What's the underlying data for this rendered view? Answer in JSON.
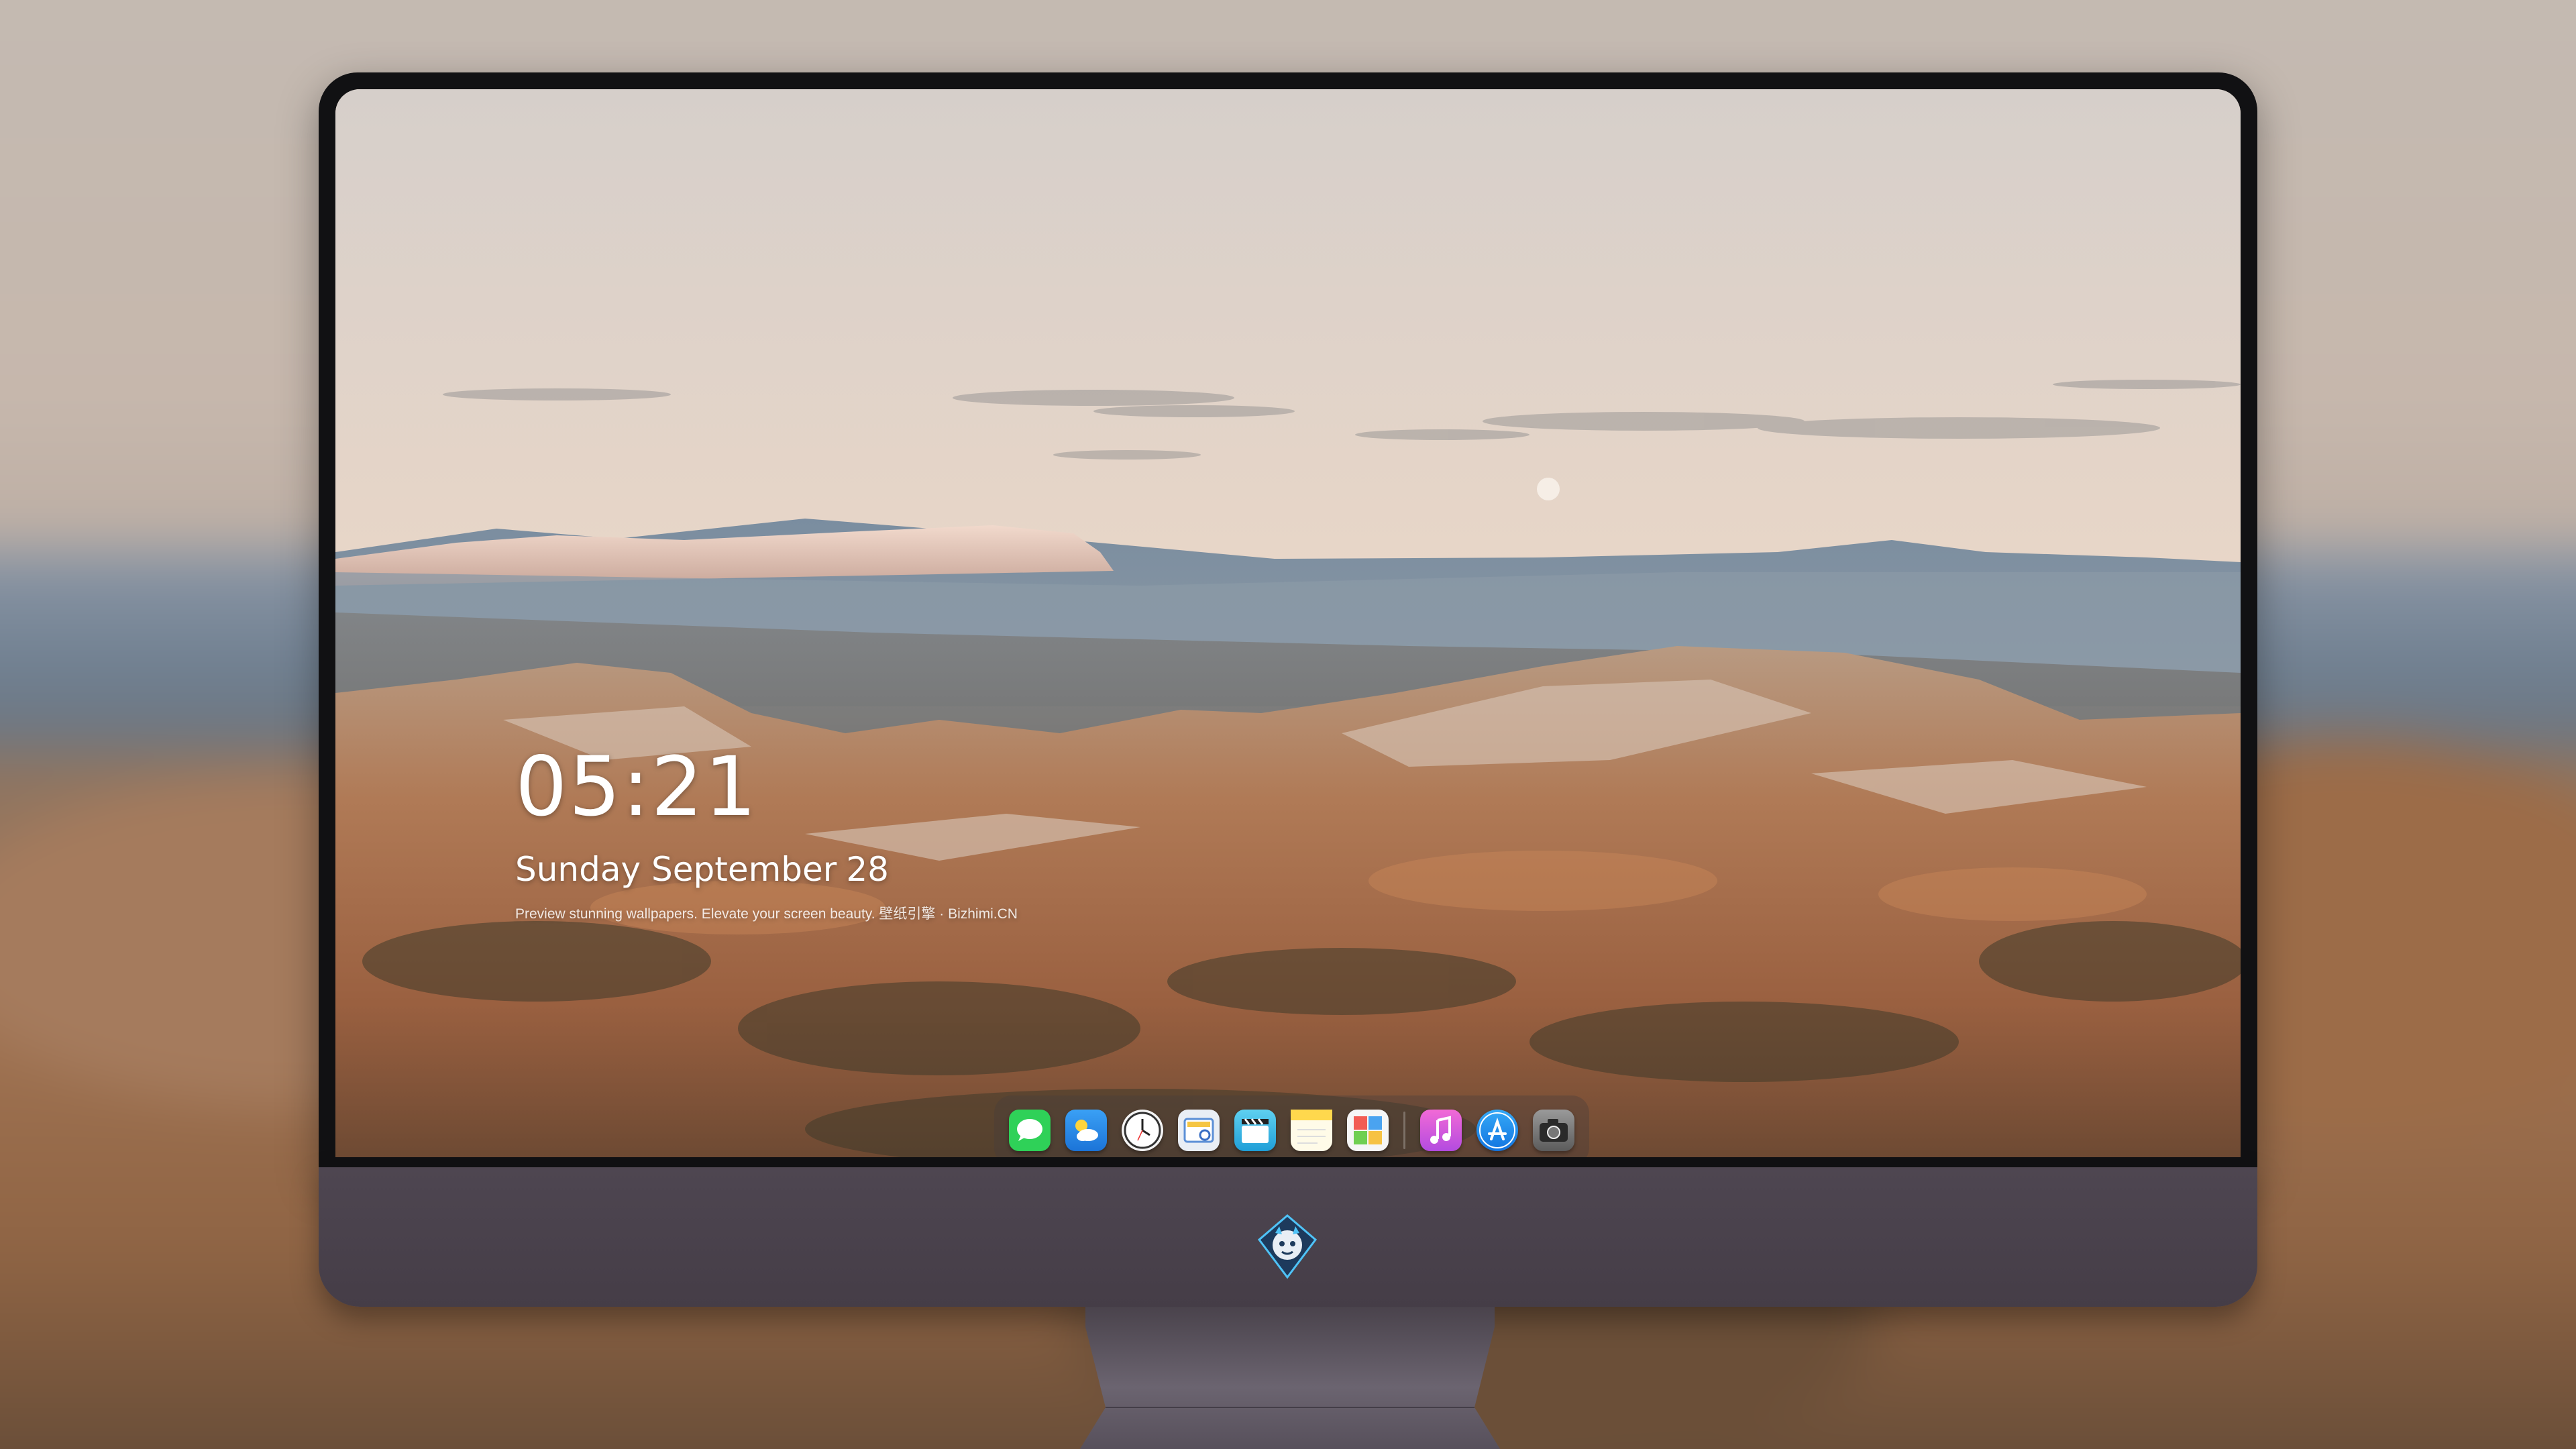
{
  "lock_screen": {
    "time": "05:21",
    "weekday_month": "Sunday September",
    "day": "28",
    "tagline": "Preview stunning wallpapers. Elevate your screen beauty. 壁纸引擎 · Bizhimi.CN"
  },
  "dock": {
    "apps": [
      {
        "name": "messages",
        "icon": "speech-bubble-icon",
        "color": "#2fd158"
      },
      {
        "name": "weather",
        "icon": "cloud-sun-icon",
        "color": "#2d8cf0"
      },
      {
        "name": "clock",
        "icon": "clock-icon",
        "color": "#f2f2f2"
      },
      {
        "name": "preview",
        "icon": "photo-viewer-icon",
        "color": "#e9eef5"
      },
      {
        "name": "video",
        "icon": "clapperboard-icon",
        "color": "#35b7e6"
      },
      {
        "name": "notes",
        "icon": "notes-icon",
        "color": "#ffd84d"
      },
      {
        "name": "photos",
        "icon": "photo-grid-icon",
        "color": "#f4f4f4"
      },
      {
        "name": "music",
        "icon": "music-note-icon",
        "color": "#e24bd6"
      },
      {
        "name": "app-store",
        "icon": "app-store-icon",
        "color": "#1e8ef0"
      },
      {
        "name": "camera",
        "icon": "camera-icon",
        "color": "#7a7a7a"
      }
    ]
  },
  "brand": {
    "logo_icon": "dragon-mascot-icon"
  }
}
